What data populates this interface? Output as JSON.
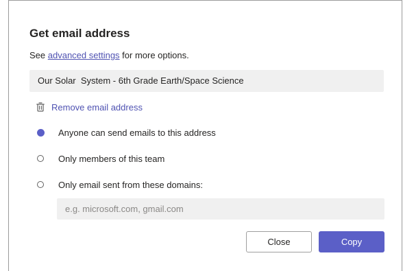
{
  "dialog": {
    "title": "Get email address",
    "subtitle_prefix": "See ",
    "subtitle_link": "advanced settings",
    "subtitle_suffix": " for more options.",
    "email_address_value": "Our Solar  System - 6th Grade Earth/Space Science",
    "remove_label": "Remove email address",
    "remove_icon": "trash-icon",
    "options": [
      {
        "label": "Anyone can send emails to this address",
        "selected": true
      },
      {
        "label": "Only members of this team",
        "selected": false
      },
      {
        "label": "Only email sent from these domains:",
        "selected": false
      }
    ],
    "domains_placeholder": "e.g. microsoft.com, gmail.com",
    "domains_value": "",
    "close_label": "Close",
    "copy_label": "Copy"
  },
  "colors": {
    "accent": "#5b5fc7",
    "link": "#4f52b2",
    "field_bg": "#f0f0f0",
    "text": "#252423"
  }
}
